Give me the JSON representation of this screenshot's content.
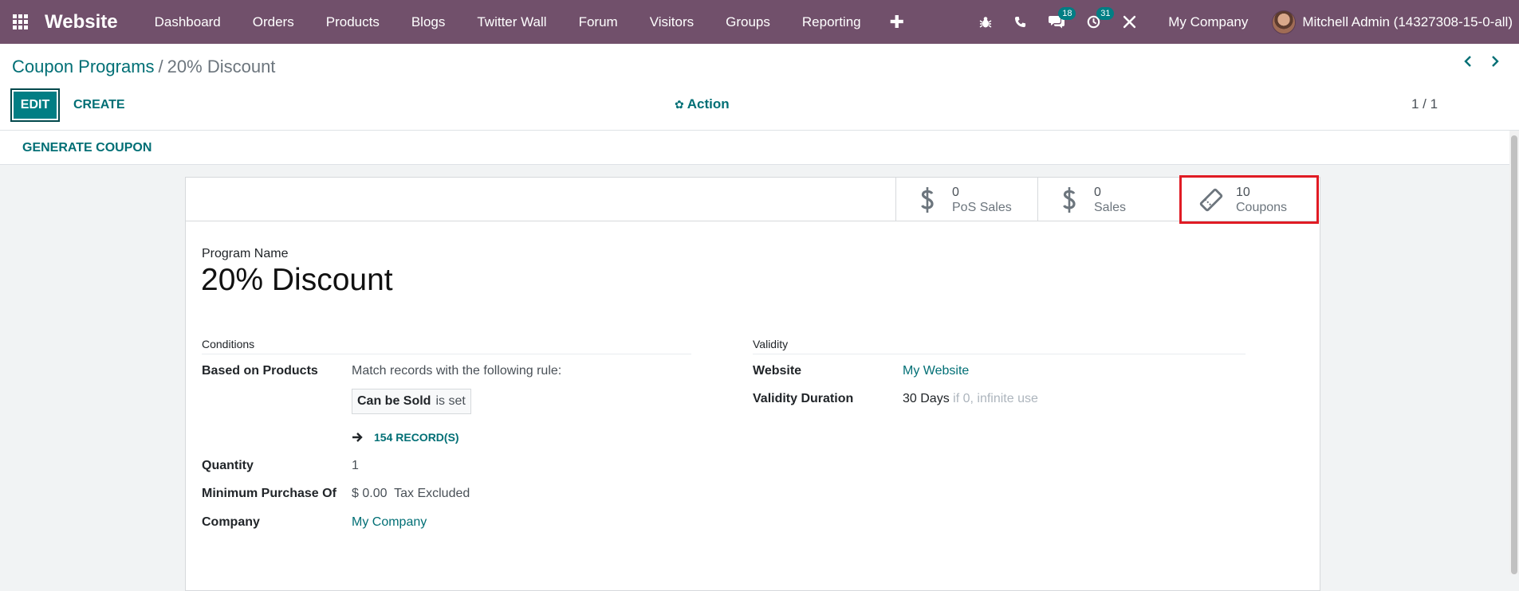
{
  "navbar": {
    "brand": "Website",
    "menu": [
      "Dashboard",
      "Orders",
      "Products",
      "Blogs",
      "Twitter Wall",
      "Forum",
      "Visitors",
      "Groups",
      "Reporting"
    ],
    "plus": "✚",
    "messages_count": "18",
    "activities_count": "31",
    "company": "My Company",
    "user": "Mitchell Admin (14327308-15-0-all)",
    "icons": [
      "apps-icon",
      "bug-icon",
      "phone-icon",
      "chat-icon",
      "clock-icon",
      "tools-icon"
    ]
  },
  "breadcrumb": {
    "parent": "Coupon Programs",
    "separator": "/",
    "current": "20% Discount"
  },
  "buttons": {
    "edit": "EDIT",
    "create": "CREATE",
    "action": "Action",
    "generate_coupon": "GENERATE COUPON"
  },
  "pager": {
    "value": "1 / 1"
  },
  "smart_buttons": [
    {
      "value": "0",
      "label": "PoS Sales",
      "icon": "dollar-icon"
    },
    {
      "value": "0",
      "label": "Sales",
      "icon": "dollar-icon"
    },
    {
      "value": "10",
      "label": "Coupons",
      "icon": "ticket-icon"
    }
  ],
  "form": {
    "program_name_label": "Program Name",
    "program_name": "20% Discount",
    "conditions": {
      "title": "Conditions",
      "based_on_products_label": "Based on Products",
      "rule_text": "Match records with the following rule:",
      "rule_field": "Can be Sold",
      "rule_op": "is set",
      "records": "154 RECORD(S)",
      "quantity_label": "Quantity",
      "quantity": "1",
      "min_purchase_label": "Minimum Purchase Of",
      "min_purchase": "$ 0.00",
      "tax_mode": "Tax Excluded",
      "company_label": "Company",
      "company": "My Company"
    },
    "validity": {
      "title": "Validity",
      "website_label": "Website",
      "website": "My Website",
      "duration_label": "Validity Duration",
      "duration": "30 Days",
      "duration_hint": "if 0, infinite use"
    }
  },
  "colors": {
    "navbar": "#71506b",
    "primary": "#017e84",
    "link": "#016f75",
    "highlight": "#e01b24"
  }
}
